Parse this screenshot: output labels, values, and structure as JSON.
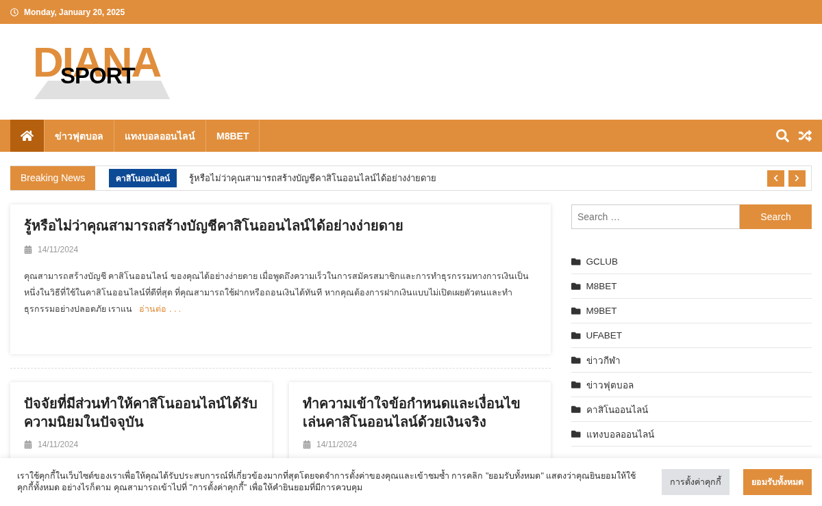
{
  "top_bar": {
    "date": "Monday, January 20, 2025"
  },
  "logo": {
    "main": "DIANA",
    "sub": "SPORT"
  },
  "nav": {
    "items": [
      {
        "kind": "home",
        "selected": true
      },
      {
        "kind": "link",
        "label": "ข่าวฟุตบอล",
        "selected": false
      },
      {
        "kind": "link",
        "label": "แทงบอลออนไลน์",
        "selected": false
      },
      {
        "kind": "link",
        "label": "M8BET",
        "selected": false
      }
    ]
  },
  "breaking": {
    "label": "Breaking News",
    "category": "คาสิโนออนไลน์",
    "headline": "รู้หรือไม่ว่าคุณสามารถสร้างบัญชีคาสิโนออนไลน์ได้อย่างง่ายดาย"
  },
  "featured": {
    "title": "รู้หรือไม่ว่าคุณสามารถสร้างบัญชีคาสิโนออนไลน์ได้อย่างง่ายดาย",
    "date": "14/11/2024",
    "excerpt": "คุณสามารถสร้างบัญชี คาสิโนออนไลน์ ของคุณได้อย่างง่ายดาย เมื่อพูดถึงความเร็วในการสมัครสมาชิกและการทำธุรกรรมทางการเงินเป็นหนึ่งในวิธีที่ใช้ในคาสิโนออนไลน์ที่ดีที่สุด ที่คุณสามารถใช้ฝากหรือถอนเงินได้ทันที หากคุณต้องการฝากเงินแบบไม่เปิดเผยตัวตนและทำธุรกรรมอย่างปลอดภัย เราแน",
    "read_more": "อ่านต่อ . . ."
  },
  "posts": [
    {
      "title": "ปัจจัยที่มีส่วนทำให้คาสิโนออนไลน์ได้รับความนิยมในปัจจุบัน",
      "date": "14/11/2024"
    },
    {
      "title": "ทำความเข้าใจข้อกำหนดและเงื่อนไขเล่นคาสิโนออนไลน์ด้วยเงินจริง",
      "date": "14/11/2024"
    }
  ],
  "sidebar": {
    "search": {
      "placeholder": "Search …",
      "button": "Search"
    },
    "categories": [
      "GCLUB",
      "M8BET",
      "M9BET",
      "UFABET",
      "ข่าวกีฬา",
      "ข่าวฟุตบอล",
      "คาสิโนออนไลน์",
      "แทงบอลออนไลน์"
    ]
  },
  "cookie_banner": {
    "text": "เราใช้คุกกี้ในเว็บไซต์ของเราเพื่อให้คุณได้รับประสบการณ์ที่เกี่ยวข้องมากที่สุดโดยจดจำการตั้งค่าของคุณและเข้าชมซ้ำ การคลิก \"ยอมรับทั้งหมด\" แสดงว่าคุณยินยอมให้ใช้คุกกี้ทั้งหมด อย่างไรก็ตาม คุณสามารถเข้าไปที่ \"การตั้งค่าคุกกี้\" เพื่อให้คำยินยอมที่มีการควบคุม",
    "buttons": [
      {
        "kind": "secondary",
        "label": "การตั้งค่าคุกกี้"
      },
      {
        "kind": "primary",
        "label": "ยอมรับทั้งหมด"
      }
    ]
  }
}
